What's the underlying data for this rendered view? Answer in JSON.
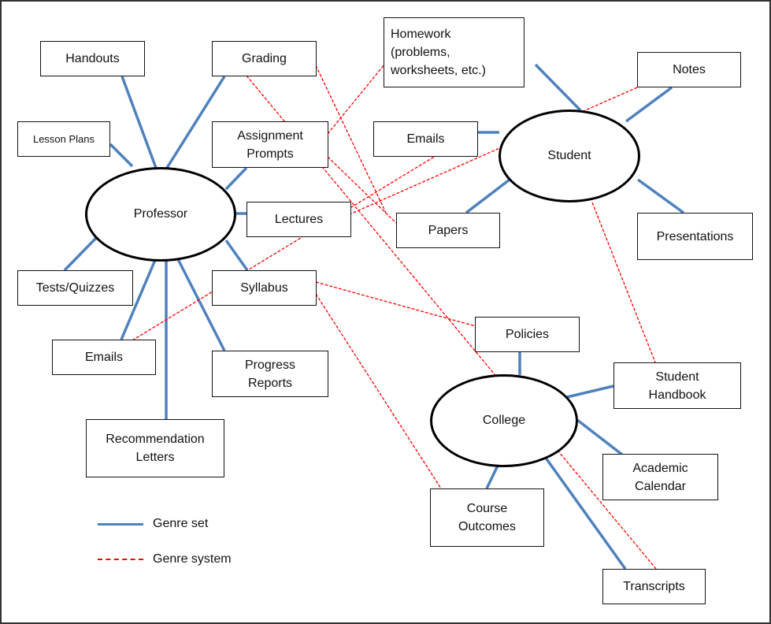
{
  "colors": {
    "genre_set": "#4f81bd",
    "genre_system": "#ff0000",
    "outline": "#000000"
  },
  "hubs": {
    "professor": "Professor",
    "student": "Student",
    "college": "College"
  },
  "professor_genres": {
    "handouts": "Handouts",
    "grading": "Grading",
    "lesson_plans": "Lesson Plans",
    "assignment_prompts": "Assignment\nPrompts",
    "lectures": "Lectures",
    "tests_quizzes": "Tests/Quizzes",
    "syllabus": "Syllabus",
    "emails": "Emails",
    "progress_reports": "Progress\nReports",
    "recommendation_letters": "Recommendation\nLetters"
  },
  "student_genres": {
    "homework": "Homework\n(problems,\nworksheets, etc.)",
    "notes": "Notes",
    "emails": "Emails",
    "papers": "Papers",
    "presentations": "Presentations"
  },
  "college_genres": {
    "policies": "Policies",
    "student_handbook": "Student\nHandbook",
    "academic_calendar": "Academic\nCalendar",
    "course_outcomes": "Course\nOutcomes",
    "transcripts": "Transcripts"
  },
  "genre_set_links": [
    [
      "professor",
      "handouts"
    ],
    [
      "professor",
      "grading"
    ],
    [
      "professor",
      "lesson_plans"
    ],
    [
      "professor",
      "assignment_prompts"
    ],
    [
      "professor",
      "lectures"
    ],
    [
      "professor",
      "tests_quizzes"
    ],
    [
      "professor",
      "syllabus"
    ],
    [
      "professor",
      "prof_emails"
    ],
    [
      "professor",
      "progress_reports"
    ],
    [
      "professor",
      "recommendation_letters"
    ],
    [
      "student",
      "homework"
    ],
    [
      "student",
      "notes"
    ],
    [
      "student",
      "student_emails"
    ],
    [
      "student",
      "papers"
    ],
    [
      "student",
      "presentations"
    ],
    [
      "college",
      "policies"
    ],
    [
      "college",
      "student_handbook"
    ],
    [
      "college",
      "academic_calendar"
    ],
    [
      "college",
      "course_outcomes"
    ],
    [
      "college",
      "transcripts"
    ]
  ],
  "genre_system_links": [
    [
      "grading",
      "papers"
    ],
    [
      "grading",
      "transcripts"
    ],
    [
      "assignment_prompts",
      "homework"
    ],
    [
      "assignment_prompts",
      "papers"
    ],
    [
      "prof_emails",
      "student_emails"
    ],
    [
      "notes",
      "lectures"
    ],
    [
      "syllabus",
      "policies"
    ],
    [
      "syllabus",
      "course_outcomes"
    ],
    [
      "student",
      "student_handbook"
    ]
  ],
  "legend": {
    "genre_set": "Genre set",
    "genre_system": "Genre system"
  }
}
